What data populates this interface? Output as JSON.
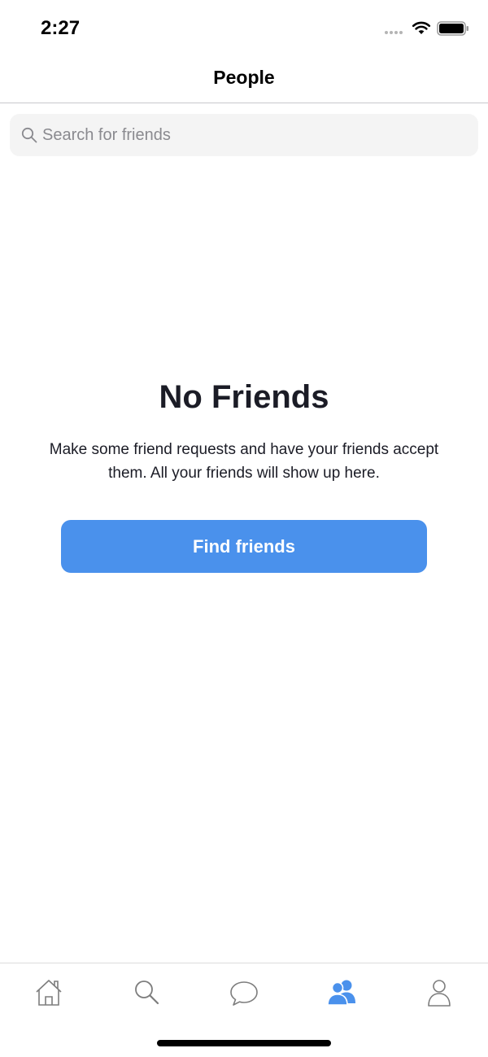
{
  "status_bar": {
    "time": "2:27"
  },
  "nav": {
    "title": "People"
  },
  "search": {
    "placeholder": "Search for friends",
    "value": ""
  },
  "empty_state": {
    "title": "No Friends",
    "message": "Make some friend requests and have your friends accept them. All your friends will show up here.",
    "button_label": "Find friends"
  },
  "tab_bar": {
    "active_tab": "people",
    "tabs": [
      {
        "id": "home",
        "icon": "home-icon"
      },
      {
        "id": "search",
        "icon": "search-icon"
      },
      {
        "id": "messages",
        "icon": "chat-bubble-icon"
      },
      {
        "id": "people",
        "icon": "people-icon"
      },
      {
        "id": "profile",
        "icon": "person-icon"
      }
    ]
  },
  "colors": {
    "accent": "#4a91ec",
    "inactive_icon": "#7d7d7d",
    "text": "#1b1c26",
    "search_bg": "#f4f4f4"
  }
}
